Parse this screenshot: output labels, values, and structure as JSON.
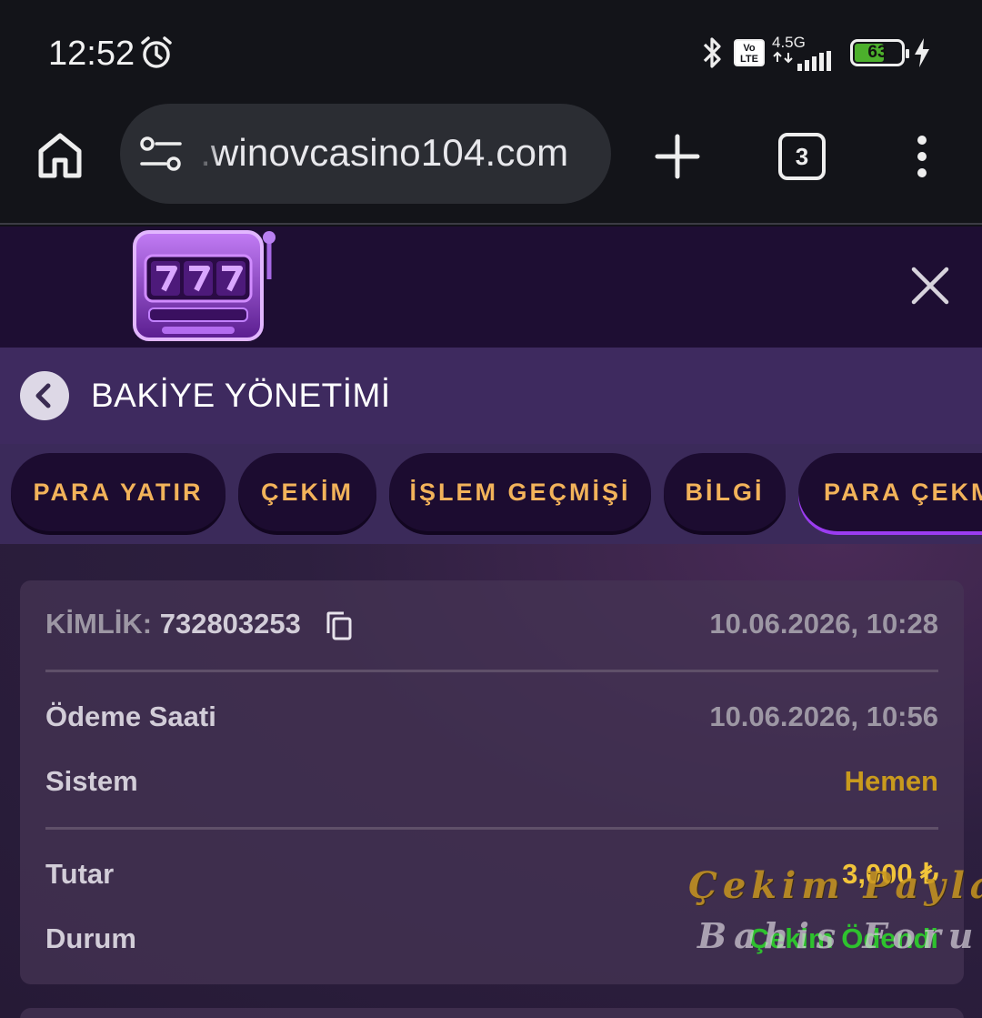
{
  "status_bar": {
    "time": "12:52",
    "network": "4.5G",
    "volte": "Vo LTE",
    "battery": "63",
    "battery_level": 0.63
  },
  "browser": {
    "url": ".winovcasino104.com",
    "tab_count": "3"
  },
  "page": {
    "title": "BAKİYE YÖNETİMİ",
    "tabs": [
      {
        "label": "PARA YATIR"
      },
      {
        "label": "ÇEKİM"
      },
      {
        "label": "İŞLEM GEÇMİŞİ"
      },
      {
        "label": "BİLGİ"
      },
      {
        "label": "PARA ÇEKM"
      }
    ]
  },
  "transaction": {
    "id_label": "KİMLİK:",
    "id_value": "732803253",
    "created": "10.06.2026, 10:28",
    "payment_time_label": "Ödeme Saati",
    "payment_time": "10.06.2026, 10:56",
    "system_label": "Sistem",
    "system_value": "Hemen",
    "amount_label": "Tutar",
    "amount_value": "3,000 ₺",
    "status_label": "Durum",
    "status_value": "Çekim Ödendi"
  },
  "watermark": {
    "line1": "Çekim Paylaş",
    "line2": "Bahis Forum"
  },
  "colors": {
    "accent_orange": "#f2b35a",
    "active_tab_underline": "#9b3cf0",
    "gold": "#c99a1d",
    "paid_green": "#2ec22e"
  }
}
